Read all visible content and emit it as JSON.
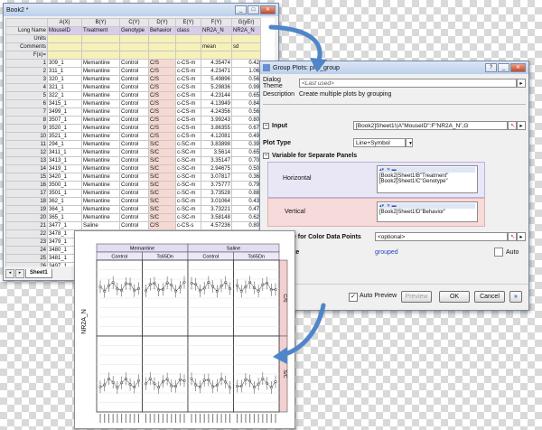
{
  "worksheet": {
    "title": "Book2 *",
    "columns": [
      {
        "head": "A(X)",
        "long_name": "MouseID",
        "units": "",
        "comments": "",
        "fx": ""
      },
      {
        "head": "B(Y)",
        "long_name": "Treatment",
        "units": "",
        "comments": "",
        "fx": ""
      },
      {
        "head": "C(Y)",
        "long_name": "Genotype",
        "units": "",
        "comments": "",
        "fx": ""
      },
      {
        "head": "D(Y)",
        "long_name": "Behavior",
        "units": "",
        "comments": "",
        "fx": ""
      },
      {
        "head": "E(Y)",
        "long_name": "class",
        "units": "",
        "comments": "",
        "fx": ""
      },
      {
        "head": "F(Y)",
        "long_name": "NR2A_N",
        "units": "",
        "comments": "mean",
        "fx": ""
      },
      {
        "head": "G(yEr)",
        "long_name": "NR2A_N",
        "units": "",
        "comments": "sd",
        "fx": ""
      }
    ],
    "row_labels": {
      "long_name": "Long Name",
      "units": "Units",
      "comments": "Comments",
      "fx": "F(x)="
    },
    "rows": [
      [
        "1",
        "309_1",
        "Memantine",
        "Control",
        "C/S",
        "c-CS-m",
        "4.35474",
        "0.42"
      ],
      [
        "2",
        "311_1",
        "Memantine",
        "Control",
        "C/S",
        "c-CS-m",
        "4.23471",
        "1.06"
      ],
      [
        "3",
        "320_1",
        "Memantine",
        "Control",
        "C/S",
        "c-CS-m",
        "5.49896",
        "0.56"
      ],
      [
        "4",
        "321_1",
        "Memantine",
        "Control",
        "C/S",
        "c-CS-m",
        "5.29836",
        "0.99"
      ],
      [
        "5",
        "322_1",
        "Memantine",
        "Control",
        "C/S",
        "c-CS-m",
        "4.23144",
        "0.65"
      ],
      [
        "6",
        "3415_1",
        "Memantine",
        "Control",
        "C/S",
        "c-CS-m",
        "4.13949",
        "0.84"
      ],
      [
        "7",
        "3499_1",
        "Memantine",
        "Control",
        "C/S",
        "c-CS-m",
        "4.24356",
        "0.56"
      ],
      [
        "8",
        "3507_1",
        "Memantine",
        "Control",
        "C/S",
        "c-CS-m",
        "3.99243",
        "0.80"
      ],
      [
        "9",
        "3520_1",
        "Memantine",
        "Control",
        "C/S",
        "c-CS-m",
        "3.86355",
        "0.67"
      ],
      [
        "10",
        "3521_1",
        "Memantine",
        "Control",
        "C/S",
        "c-CS-m",
        "4.12081",
        "0.49"
      ],
      [
        "11",
        "294_1",
        "Memantine",
        "Control",
        "S/C",
        "c-SC-m",
        "3.83898",
        "0.39"
      ],
      [
        "12",
        "3411_1",
        "Memantine",
        "Control",
        "S/C",
        "c-SC-m",
        "3.5614",
        "0.65"
      ],
      [
        "13",
        "3413_1",
        "Memantine",
        "Control",
        "S/C",
        "c-SC-m",
        "3.35147",
        "0.70"
      ],
      [
        "14",
        "3419_1",
        "Memantine",
        "Control",
        "S/C",
        "c-SC-m",
        "2.94675",
        "0.50"
      ],
      [
        "15",
        "3420_1",
        "Memantine",
        "Control",
        "S/C",
        "c-SC-m",
        "3.07817",
        "0.36"
      ],
      [
        "16",
        "3500_1",
        "Memantine",
        "Control",
        "S/C",
        "c-SC-m",
        "3.75777",
        "0.79"
      ],
      [
        "17",
        "3501_1",
        "Memantine",
        "Control",
        "S/C",
        "c-SC-m",
        "3.73528",
        "0.88"
      ],
      [
        "18",
        "362_1",
        "Memantine",
        "Control",
        "S/C",
        "c-SC-m",
        "3.01064",
        "0.43"
      ],
      [
        "19",
        "364_1",
        "Memantine",
        "Control",
        "S/C",
        "c-SC-m",
        "3.73221",
        "0.47"
      ],
      [
        "20",
        "365_1",
        "Memantine",
        "Control",
        "S/C",
        "c-SC-m",
        "3.58148",
        "0.62"
      ],
      [
        "21",
        "3477_1",
        "Saline",
        "Control",
        "C/S",
        "c-CS-s",
        "4.57236",
        "0.80"
      ],
      [
        "22",
        "3478_1",
        "Saline",
        "Control",
        "C/S",
        "c-CS-s",
        "4.26951",
        "0.54"
      ],
      [
        "23",
        "3479_1",
        "Saline",
        "Control",
        "C/S",
        "c-CS-s",
        "3.99472",
        "0.37"
      ],
      [
        "24",
        "3480_1",
        "Saline",
        "Control",
        "C/S",
        "c-CS-s",
        "",
        ""
      ],
      [
        "25",
        "3481_1",
        "Saline",
        "Control",
        "C/S",
        "c-CS-s",
        "",
        ""
      ],
      [
        "26",
        "3497_1",
        "Saline",
        "Control",
        "C/S",
        "c-CS-s",
        "",
        ""
      ],
      [
        "27",
        "5081_1",
        "Saline",
        "Control",
        "C/S",
        "c-CS-s",
        "",
        ""
      ]
    ],
    "sheet_tab": "Sheet1"
  },
  "dialog": {
    "title": "Group Plots: plot_group",
    "theme_label": "Dialog Theme",
    "theme_value": "<Last used>",
    "description_label": "Description",
    "description_value": "Create multiple plots by grouping",
    "input_label": "Input",
    "input_value": "[Book2]Sheet1!(A\"MouseID\":F\"NR2A_N\",G",
    "plot_type_label": "Plot Type",
    "plot_type_value": "Line+Symbol",
    "panels_label": "Variable for Separate Panels",
    "horizontal_label": "Horizontal",
    "horizontal_items": [
      "[Book2]Sheet1!B\"Treatment\"",
      "[Book2]Sheet1!C\"Genotype\""
    ],
    "vertical_label": "Vertical",
    "vertical_items": [
      "[Book2]Sheet1!D\"Behavior\""
    ],
    "color_label": "Variable for Color Data Points",
    "color_value": "<optional>",
    "template_label": "Template",
    "template_value": "grouped",
    "auto_label": "Auto",
    "auto_preview_label": "Auto Preview",
    "preview_button": "Preview",
    "ok_button": "OK",
    "cancel_button": "Cancel"
  },
  "graph": {
    "treatments": [
      "Memantine",
      "Saline"
    ],
    "genotypes": [
      "Control",
      "Ts65Dn",
      "Control",
      "Ts65Dn"
    ],
    "behaviors": [
      "C/S",
      "S/C"
    ],
    "ylabel": "NR2A_N"
  },
  "colors": {
    "purple_header": "#d8ccec",
    "yellow_band": "#f6f1b8",
    "peach_col": "#f7d9d3",
    "arrow_blue": "#4f86c9"
  }
}
